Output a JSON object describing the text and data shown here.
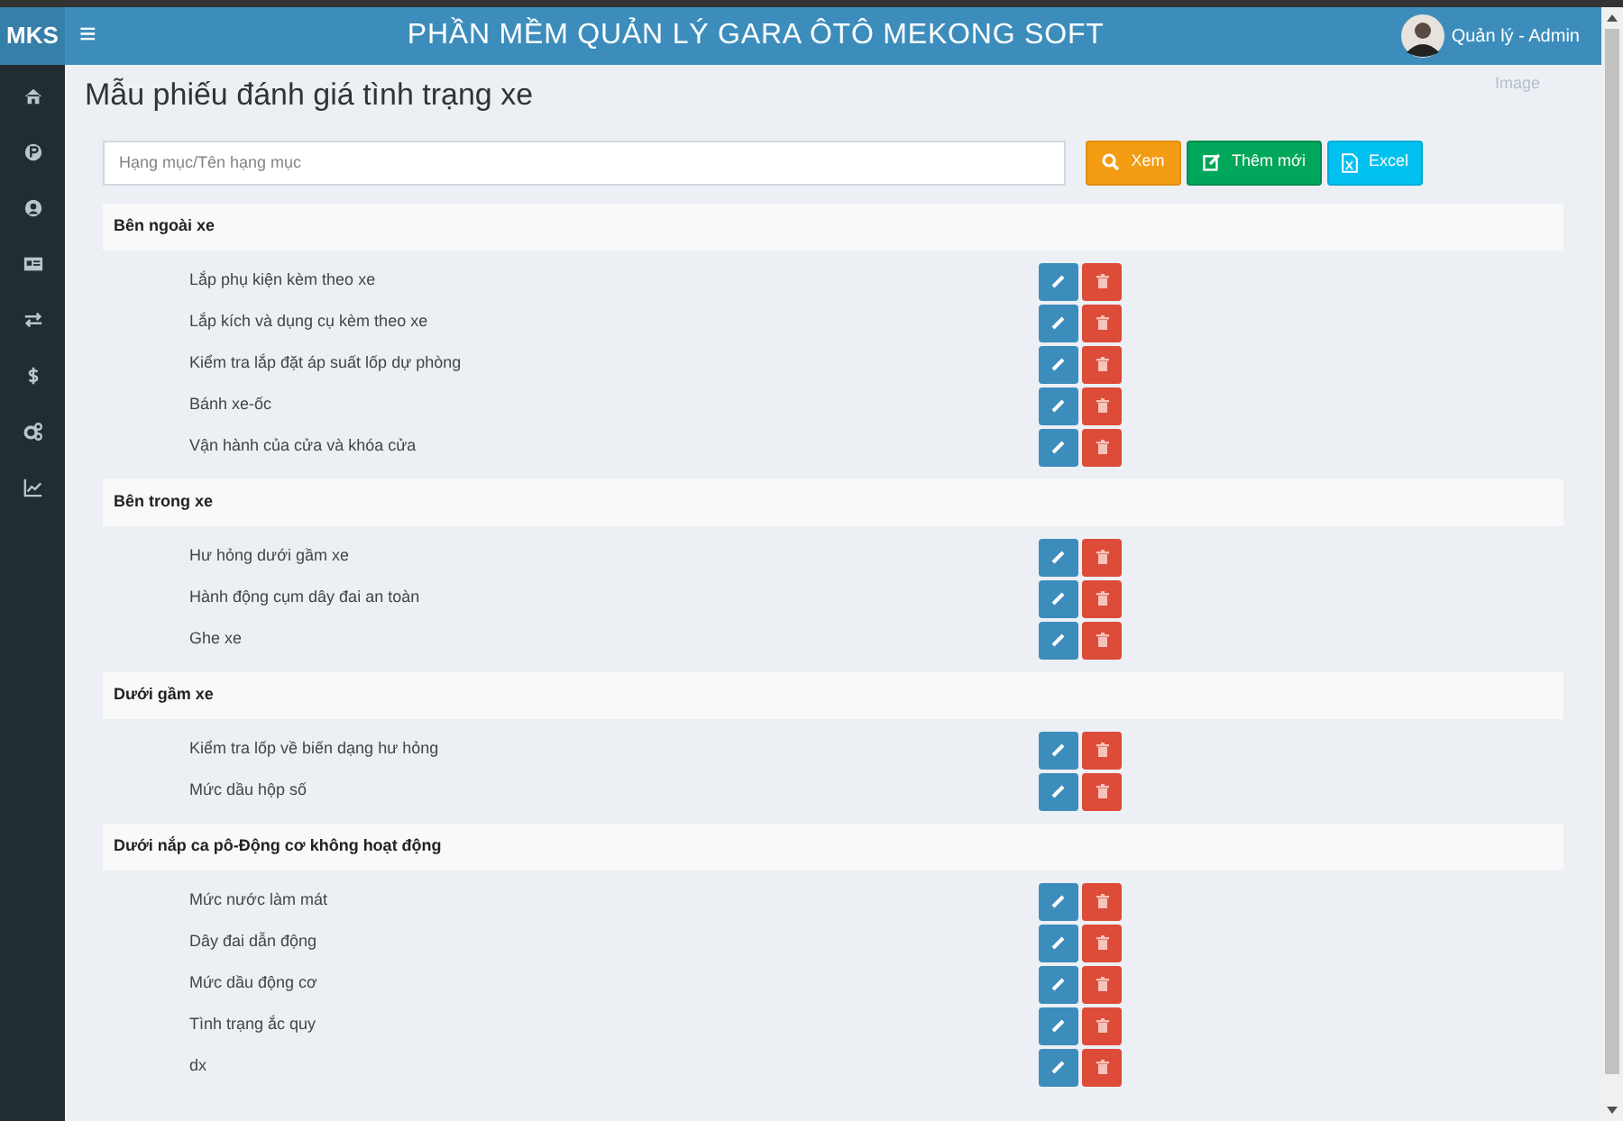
{
  "header": {
    "logo": "MKS",
    "menu_toggle": "≡",
    "title": "PHẦN MỀM QUẢN LÝ GARA ÔTÔ MEKONG SOFT",
    "user": "Quản lý - Admin",
    "avatar_alt": "Image"
  },
  "page_title": "Mẫu phiếu đánh giá tình trạng xe",
  "search": {
    "placeholder": "Hạng mục/Tên hạng mục"
  },
  "actions": [
    {
      "kind": "view",
      "label": "Xem"
    },
    {
      "kind": "add",
      "label": "Thêm mới"
    },
    {
      "kind": "excel",
      "label": "Excel"
    }
  ],
  "groups": [
    {
      "title": "Bên ngoài xe",
      "items": [
        "Lắp phụ kiện kèm theo xe",
        "Lắp kích và dụng cụ kèm theo xe",
        "Kiểm tra lắp đặt áp suất lốp dự phòng",
        "Bánh xe-ốc",
        "Vận hành của cửa và khóa cửa"
      ]
    },
    {
      "title": "Bên trong xe",
      "items": [
        "Hư hỏng dưới gầm xe",
        "Hành động cụm dây đai an toàn",
        "Ghe xe"
      ]
    },
    {
      "title": "Dưới gầm xe",
      "items": [
        "Kiểm tra lốp về biến dạng hư hỏng",
        "Mức dầu hộp số"
      ]
    },
    {
      "title": "Dưới nắp ca pô-Động cơ không hoạt động",
      "items": [
        "Mức nước làm mát",
        "Dây đai dẫn động",
        "Mức dầu động cơ",
        "Tình trạng ắc quy",
        "dx"
      ]
    }
  ]
}
